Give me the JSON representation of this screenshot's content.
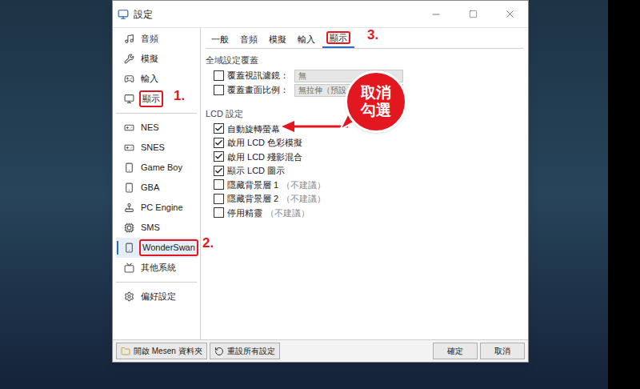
{
  "window": {
    "title": "設定"
  },
  "sidebar": {
    "groups": [
      [
        {
          "label": "音頻",
          "selected": false,
          "marked": false
        },
        {
          "label": "模擬",
          "selected": false,
          "marked": false
        },
        {
          "label": "輸入",
          "selected": false,
          "marked": false
        },
        {
          "label": "顯示",
          "selected": false,
          "marked": true
        }
      ],
      [
        {
          "label": "NES",
          "selected": false,
          "marked": false
        },
        {
          "label": "SNES",
          "selected": false,
          "marked": false
        },
        {
          "label": "Game Boy",
          "selected": false,
          "marked": false
        },
        {
          "label": "GBA",
          "selected": false,
          "marked": false
        },
        {
          "label": "PC Engine",
          "selected": false,
          "marked": false
        },
        {
          "label": "SMS",
          "selected": false,
          "marked": false
        },
        {
          "label": "WonderSwan",
          "selected": true,
          "marked": true
        },
        {
          "label": "其他系統",
          "selected": false,
          "marked": false
        }
      ],
      [
        {
          "label": "偏好設定",
          "selected": false,
          "marked": false
        }
      ]
    ]
  },
  "tabs": [
    {
      "label": "一般",
      "selected": false,
      "marked": false
    },
    {
      "label": "音頻",
      "selected": false,
      "marked": false
    },
    {
      "label": "模擬",
      "selected": false,
      "marked": false
    },
    {
      "label": "輸入",
      "selected": false,
      "marked": false
    },
    {
      "label": "顯示",
      "selected": true,
      "marked": true
    }
  ],
  "global_override": {
    "title": "全域設定覆蓋",
    "rows": [
      {
        "label": "覆蓋視訊濾鏡：",
        "checked": false,
        "value": "無",
        "disabled": true
      },
      {
        "label": "覆蓋畫面比例：",
        "checked": false,
        "value": "無拉伸（預設）",
        "disabled": true
      }
    ]
  },
  "lcd": {
    "title": "LCD 設定",
    "options": [
      {
        "label": "自動旋轉螢幕",
        "checked": true
      },
      {
        "label": "啟用 LCD 色彩模擬",
        "checked": true
      },
      {
        "label": "啟用 LCD 殘影混合",
        "checked": true
      },
      {
        "label": "顯示 LCD 圖示",
        "checked": true
      },
      {
        "label": "隱藏背景層 1",
        "note": "（不建議）",
        "checked": false
      },
      {
        "label": "隱藏背景層 2",
        "note": "（不建議）",
        "checked": false
      },
      {
        "label": "停用精靈",
        "note": "（不建議）",
        "checked": false
      }
    ]
  },
  "footer": {
    "left_buttons": [
      "開啟 Mesen 資料夾",
      "重設所有設定"
    ],
    "right_buttons": [
      "確定",
      "取消"
    ]
  },
  "annotations": {
    "steps": [
      "1.",
      "2.",
      "3."
    ],
    "callout": "取消勾選"
  }
}
